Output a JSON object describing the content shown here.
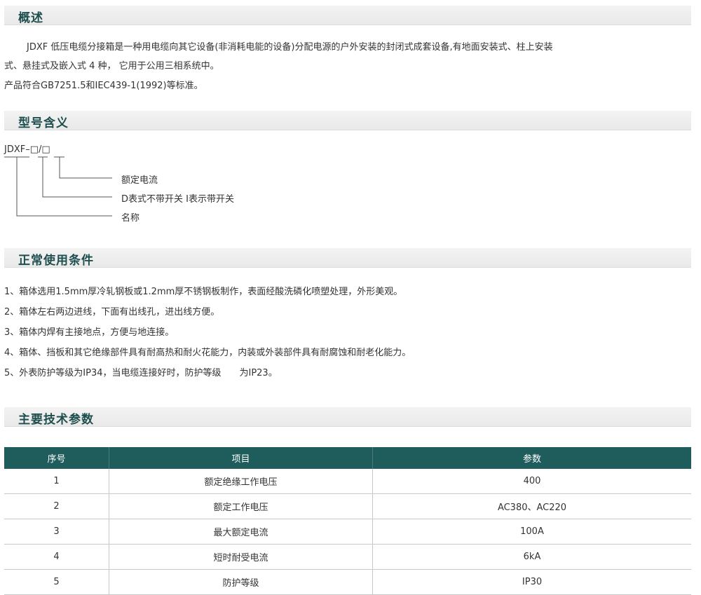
{
  "overview": {
    "heading": "概述",
    "para1_line1": "JDXF 低压电缆分接箱是一种用电缆向其它设备(非消耗电能的设备)分配电源的户外安装的封闭式成套设备,有地面安装式、柱上安装",
    "para1_line2": "式、悬挂式及嵌入式 4 种， 它用于公用三相系统中。",
    "para2": "产品符合GB7251.5和IEC439-1(1992)等标准。"
  },
  "model": {
    "heading": "型号含义",
    "code": "JDXF–□/□",
    "legend": [
      "额定电流",
      "D表式不带开关 I表示带开关",
      "名称"
    ]
  },
  "conditions": {
    "heading": "正常使用条件",
    "items": [
      "1、箱体选用1.5mm厚冷轧钢板或1.2mm厚不锈钢板制作，表面经酸洗磷化喷塑处理，外形美观。",
      "2、箱体左右两边进线，下面有出线孔，进出线方便。",
      "3、箱体内焊有主接地点，方便与地连接。",
      "4、箱体、挡板和其它绝缘部件具有耐高热和耐火花能力，内装或外装部件具有耐腐蚀和耐老化能力。",
      "5、外表防护等级为IP34，当电缆连接好时，防护等级　　为IP23。"
    ]
  },
  "specs": {
    "heading": "主要技术参数",
    "headers": [
      "序号",
      "项目",
      "参数"
    ],
    "rows": [
      [
        "1",
        "额定绝缘工作电压",
        "400"
      ],
      [
        "2",
        "额定工作电压",
        "AC380、AC220"
      ],
      [
        "3",
        "最大额定电流",
        "100A"
      ],
      [
        "4",
        "短时耐受电流",
        "6kA"
      ],
      [
        "5",
        "防护等级",
        "IP30"
      ]
    ]
  },
  "colors": {
    "heading_text": "#1f4e4e",
    "table_header_bg": "#1f5c5c",
    "section_bar_bg": "#ececec"
  }
}
